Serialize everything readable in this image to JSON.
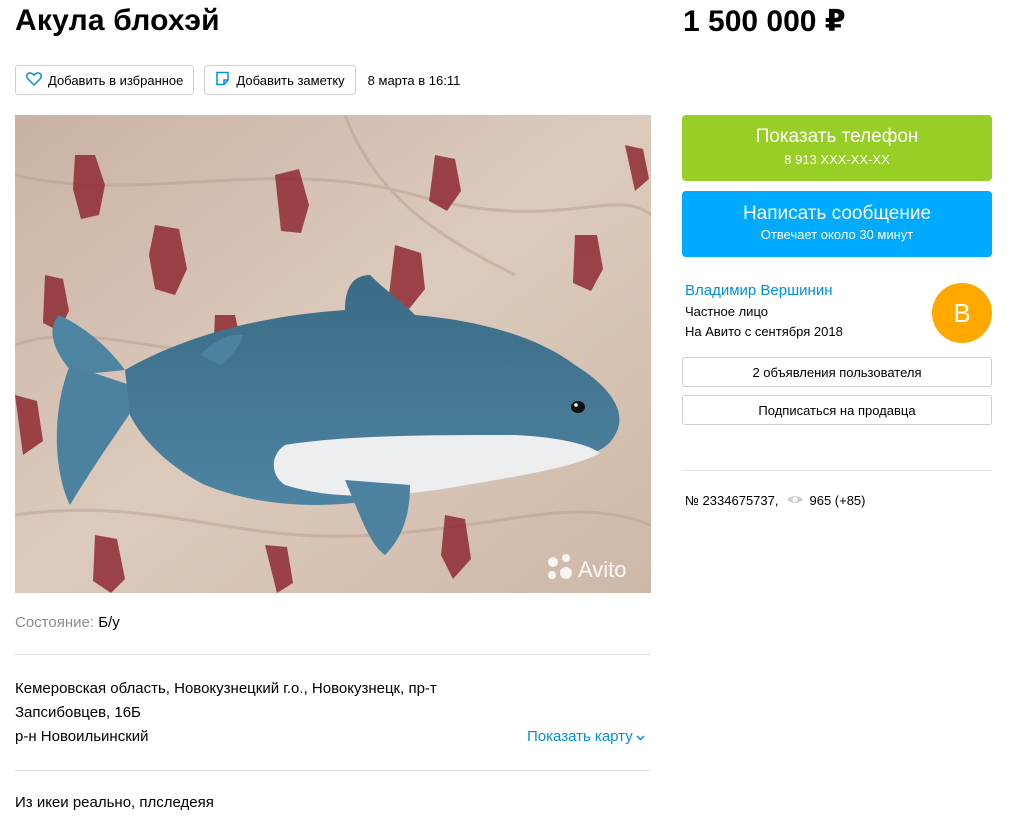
{
  "listing": {
    "title": "Акула блохэй",
    "price": "1 500 000 ₽",
    "add_favorite": "Добавить в избранное",
    "add_note": "Добавить заметку",
    "date": "8 марта в 16:11",
    "photo_watermark": "Avito",
    "condition_label": "Состояние:",
    "condition_value": "Б/у",
    "address_line1": "Кемеровская область, Новокузнецкий г.о., Новокузнецк, пр-т",
    "address_line2": "Запсибовцев, 16Б",
    "district": "р-н Новоильинский",
    "show_map": "Показать карту",
    "description": "Из икеи реально, плследеяя"
  },
  "contact": {
    "phone_label": "Показать телефон",
    "phone_masked": "8 913 XXX-XX-XX",
    "message_label": "Написать сообщение",
    "message_sub": "Отвечает около 30 минут"
  },
  "seller": {
    "name": "Владимир Вершинин",
    "type": "Частное лицо",
    "since": "На Авито с сентября 2018",
    "avatar_letter": "В",
    "avatar_color": "#ffa800",
    "listings_button": "2 объявления пользователя",
    "subscribe_button": "Подписаться на продавца"
  },
  "stats": {
    "ad_number": "№ 2334675737,",
    "views": "965 (+85)"
  },
  "colors": {
    "phone_button": "#97cf26",
    "message_button": "#00aaff",
    "link": "#0091d9"
  }
}
